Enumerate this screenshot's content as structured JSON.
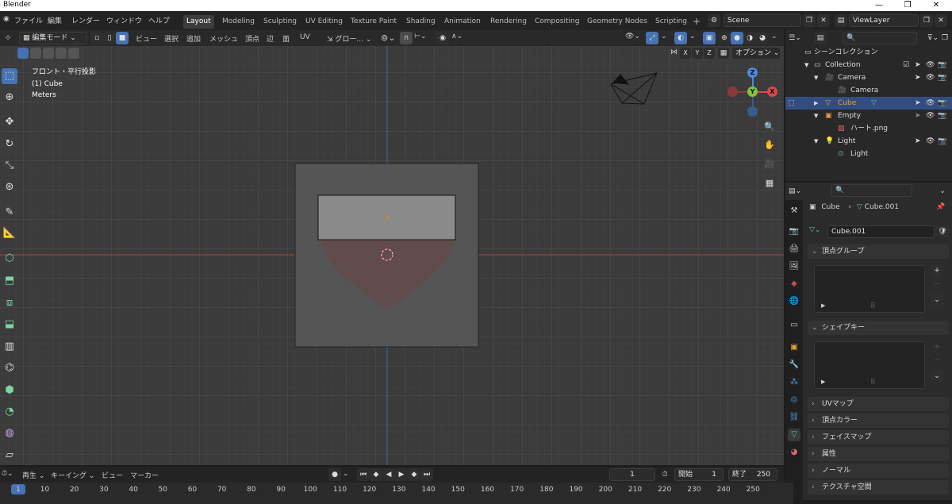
{
  "window": {
    "title": "Blender",
    "controls": [
      "—",
      "❐",
      "✕"
    ]
  },
  "menus": [
    "ファイル",
    "編集",
    "レンダー",
    "ウィンドウ",
    "ヘルプ"
  ],
  "workspaces": [
    "Layout",
    "Modeling",
    "Sculpting",
    "UV Editing",
    "Texture Paint",
    "Shading",
    "Animation",
    "Rendering",
    "Compositing",
    "Geometry Nodes",
    "Scripting"
  ],
  "scene": {
    "label": "Scene",
    "view_layer": "ViewLayer",
    "add": "+"
  },
  "viewport_header": {
    "mode": "編集モード",
    "menus": [
      "ビュー",
      "選択",
      "追加",
      "メッシュ",
      "頂点",
      "辺",
      "面",
      "UV"
    ],
    "transform_orientation": "グロー...",
    "axes": [
      "X",
      "Y",
      "Z"
    ],
    "options": "オプション"
  },
  "overlay_text": {
    "view": "フロント・平行投影",
    "object": "(1) Cube",
    "units": "Meters"
  },
  "gizmo": {
    "z": "Z",
    "y": "Y",
    "x": "X"
  },
  "outliner": {
    "search_placeholder": "",
    "rows": [
      {
        "label": "シーンコレクション"
      },
      {
        "label": "Collection"
      },
      {
        "label": "Camera"
      },
      {
        "label": "Camera"
      },
      {
        "label": "Cube"
      },
      {
        "label": "Empty"
      },
      {
        "label": "ハート.png"
      },
      {
        "label": "Light"
      },
      {
        "label": "Light"
      }
    ]
  },
  "properties": {
    "breadcrumb_object": "Cube",
    "breadcrumb_sep": "›",
    "breadcrumb_data": "Cube.001",
    "datablock_name": "Cube.001",
    "panels": {
      "vertex_groups": "頂点グループ",
      "shape_keys": "シェイプキー",
      "uv_maps": "UVマップ",
      "vertex_colors": "頂点カラー",
      "face_maps": "フェイスマップ",
      "attributes": "属性",
      "normals": "ノーマル",
      "texture_space": "テクスチャ空間"
    }
  },
  "timeline": {
    "menus": [
      "再生",
      "キーイング",
      "ビュー",
      "マーカー"
    ],
    "current_frame": "1",
    "start_label": "開始",
    "start": "1",
    "end_label": "終了",
    "end": "250",
    "ticks": [
      "1",
      "10",
      "20",
      "30",
      "40",
      "50",
      "60",
      "70",
      "80",
      "90",
      "100",
      "110",
      "120",
      "130",
      "140",
      "150",
      "160",
      "170",
      "180",
      "190",
      "200",
      "210",
      "220",
      "230",
      "240",
      "250"
    ]
  },
  "colors": {
    "accent": "#4772b3",
    "selection": "#334d80",
    "x_axis": "#d94a4a",
    "y_axis": "#7ec53d",
    "z_axis": "#4a8ad9"
  }
}
